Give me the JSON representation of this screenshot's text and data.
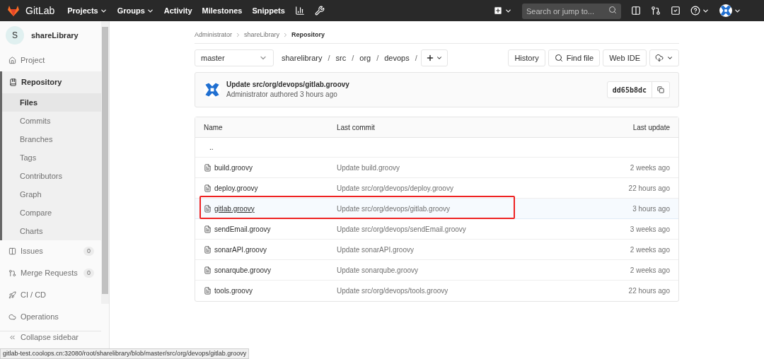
{
  "top_bar": {
    "brand": "GitLab",
    "nav": [
      {
        "label": "Projects",
        "dropdown": true
      },
      {
        "label": "Groups",
        "dropdown": true
      },
      {
        "label": "Activity",
        "dropdown": false
      },
      {
        "label": "Milestones",
        "dropdown": false
      },
      {
        "label": "Snippets",
        "dropdown": false
      }
    ],
    "search": {
      "placeholder": "Search or jump to..."
    }
  },
  "sidebar": {
    "project_initial": "S",
    "project_name": "shareLibrary",
    "items": [
      {
        "label": "Project",
        "expanded": false
      },
      {
        "label": "Repository",
        "expanded": true,
        "children": [
          {
            "label": "Files",
            "selected": true
          },
          {
            "label": "Commits",
            "selected": false
          },
          {
            "label": "Branches",
            "selected": false
          },
          {
            "label": "Tags",
            "selected": false
          },
          {
            "label": "Contributors",
            "selected": false
          },
          {
            "label": "Graph",
            "selected": false
          },
          {
            "label": "Compare",
            "selected": false
          },
          {
            "label": "Charts",
            "selected": false
          }
        ]
      },
      {
        "label": "Issues",
        "expanded": false,
        "count": "0"
      },
      {
        "label": "Merge Requests",
        "expanded": false,
        "count": "0"
      },
      {
        "label": "CI / CD",
        "expanded": false
      },
      {
        "label": "Operations",
        "expanded": false
      }
    ],
    "collapse": "Collapse sidebar"
  },
  "breadcrumbs": [
    {
      "label": "Administrator",
      "current": false
    },
    {
      "label": "shareLibrary",
      "current": false
    },
    {
      "label": "Repository",
      "current": true
    }
  ],
  "toolbar": {
    "branch": "master",
    "path": [
      {
        "label": "sharelibrary",
        "separator": "/"
      },
      {
        "label": "src",
        "separator": "/"
      },
      {
        "label": "org",
        "separator": "/"
      },
      {
        "label": "devops",
        "separator": "/"
      }
    ],
    "buttons": [
      "History",
      "Find file",
      "Web IDE"
    ]
  },
  "last_commit": {
    "title": "Update src/org/devops/gitlab.groovy",
    "meta": "Administrator authored 3 hours ago",
    "sha": "dd65b8dc"
  },
  "table": {
    "columns": [
      "Name",
      "Last commit",
      "Last update"
    ],
    "parent": "..",
    "rows": [
      {
        "name": "build.groovy",
        "commit": "Update build.groovy",
        "updated": "2 weeks ago",
        "selected": false
      },
      {
        "name": "deploy.groovy",
        "commit": "Update src/org/devops/deploy.groovy",
        "updated": "22 hours ago",
        "selected": false
      },
      {
        "name": "gitlab.groovy",
        "commit": "Update src/org/devops/gitlab.groovy",
        "updated": "3 hours ago",
        "selected": true
      },
      {
        "name": "sendEmail.groovy",
        "commit": "Update src/org/devops/sendEmail.groovy",
        "updated": "3 weeks ago",
        "selected": false
      },
      {
        "name": "sonarAPI.groovy",
        "commit": "Update sonarAPI.groovy",
        "updated": "2 weeks ago",
        "selected": false
      },
      {
        "name": "sonarqube.groovy",
        "commit": "Update sonarqube.groovy",
        "updated": "2 weeks ago",
        "selected": false
      },
      {
        "name": "tools.groovy",
        "commit": "Update src/org/devops/tools.groovy",
        "updated": "22 hours ago",
        "selected": false
      }
    ]
  },
  "status_bar": "gitlab-test.coolops.cn:32080/root/sharelibrary/blob/master/src/org/devops/gitlab.groovy"
}
